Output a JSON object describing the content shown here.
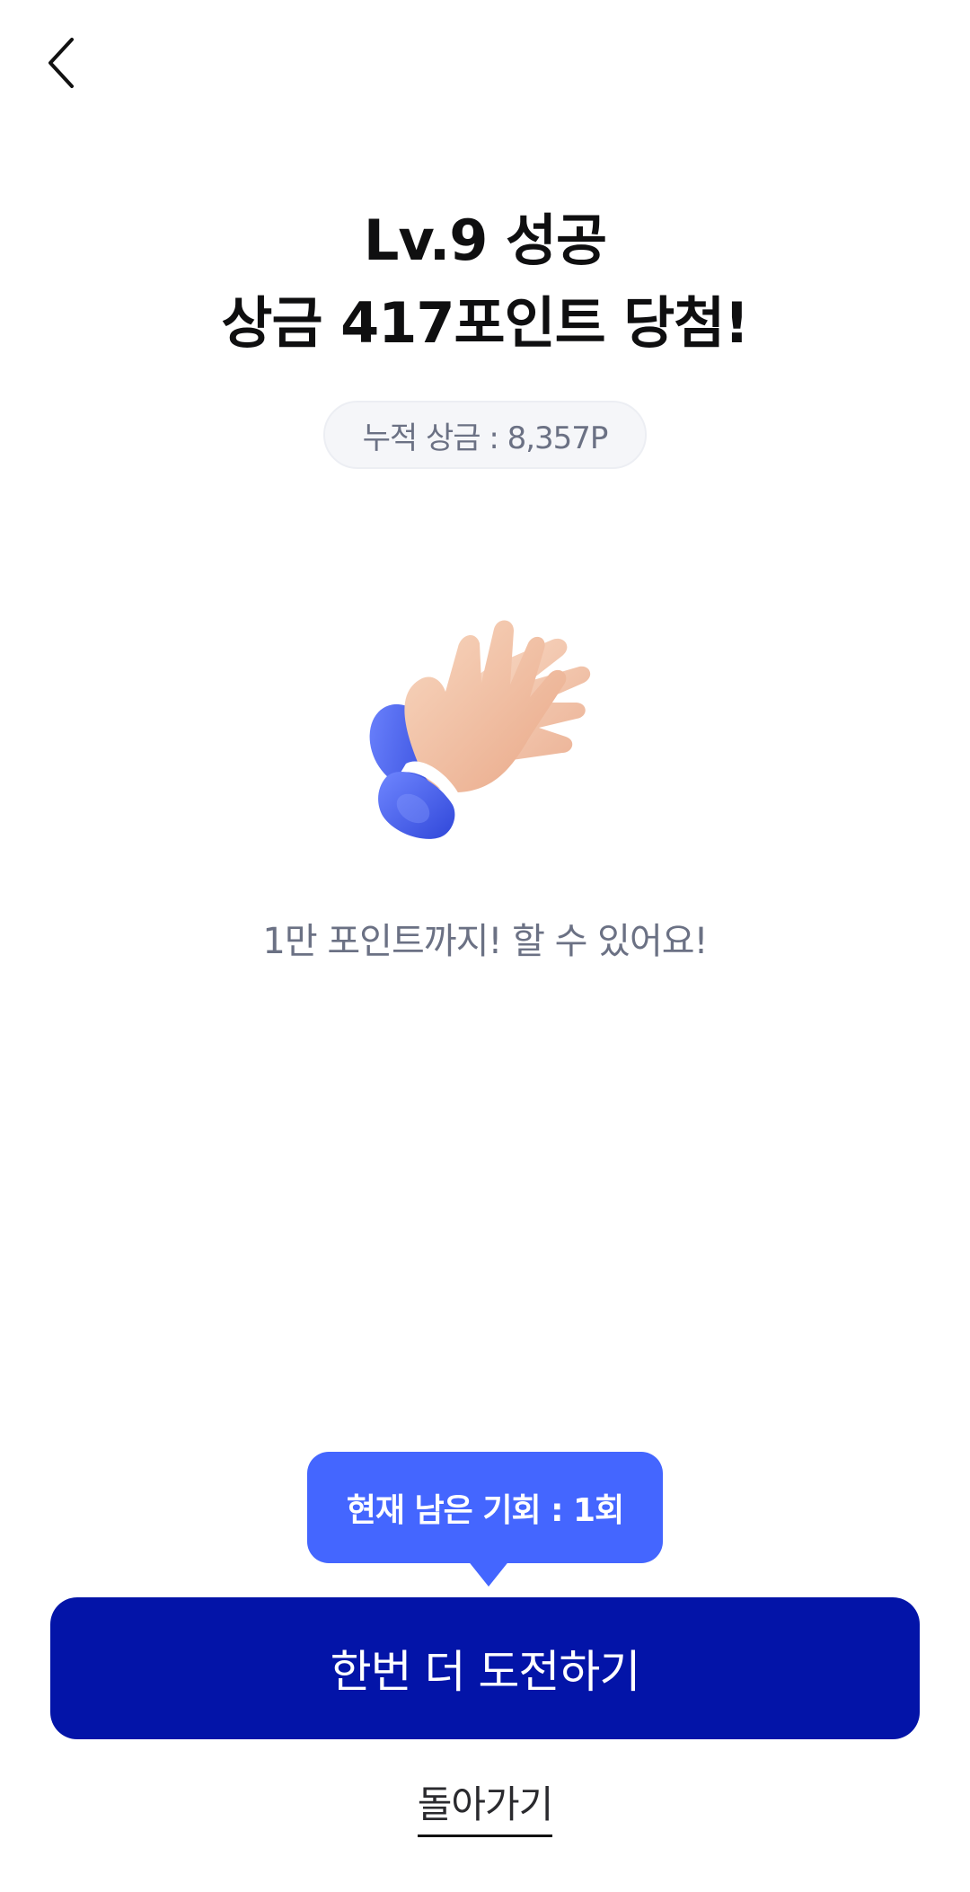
{
  "header": {
    "back_icon": "chevron-left-icon"
  },
  "result": {
    "title_line1": "Lv.9 성공",
    "title_line2": "상금 417포인트 당첨!",
    "accumulated_prize": "누적 상금 : 8,357P",
    "illustration": "clapping-hands-icon",
    "message": "1만 포인트까지! 할 수 있어요!"
  },
  "footer": {
    "tooltip": "현재 남은 기회 : 1회",
    "retry_button": "한번 더 도전하기",
    "go_back_link": "돌아가기"
  },
  "colors": {
    "primary_button": "#0314a8",
    "tooltip": "#4466ff",
    "sleeve": "#4b63f2",
    "skin": "#f3c6a8"
  }
}
